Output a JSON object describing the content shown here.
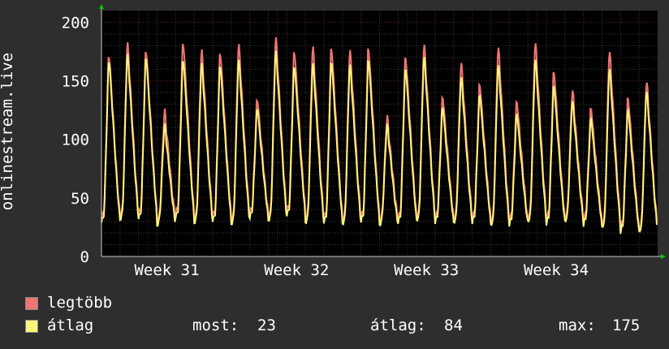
{
  "chart_data": {
    "type": "line",
    "title": "",
    "ylabel": "onlinestream.live",
    "xlabel": "",
    "ylim": [
      0,
      210
    ],
    "yticks": [
      0,
      50,
      100,
      150,
      200
    ],
    "xticks": [
      "Week 31",
      "Week 32",
      "Week 33",
      "Week 34"
    ],
    "x_range_days": 30,
    "week_tick_day_positions": [
      3,
      10,
      17,
      24
    ],
    "grid": true,
    "legend_placement": "bottom-left",
    "daily_peaks_max": [
      172,
      181,
      176,
      122,
      183,
      175,
      174,
      180,
      133,
      186,
      175,
      178,
      178,
      175,
      178,
      117,
      170,
      180,
      135,
      164,
      146,
      178,
      131,
      182,
      157,
      140,
      125,
      175,
      134,
      148
    ],
    "daily_peaks_avg": [
      167,
      172,
      170,
      110,
      168,
      164,
      163,
      167,
      125,
      175,
      162,
      164,
      166,
      163,
      168,
      110,
      160,
      170,
      126,
      152,
      137,
      163,
      120,
      168,
      145,
      131,
      116,
      160,
      124,
      140
    ],
    "daily_min": [
      32,
      34,
      35,
      29,
      36,
      31,
      33,
      30,
      36,
      33,
      38,
      31,
      32,
      30,
      33,
      29,
      32,
      33,
      32,
      31,
      32,
      29,
      30,
      32,
      31,
      32,
      30,
      27,
      24,
      23
    ],
    "series": [
      {
        "name": "legtöbb",
        "color": "#f07474"
      },
      {
        "name": "átlag",
        "color": "#fff47a"
      }
    ]
  },
  "colors": {
    "background": "#2e2e2e",
    "plot_bg": "#000000",
    "grid": "#3a3a3a",
    "grid_major": "#5a2222",
    "axis": "#c8c8c8",
    "arrow": "#00cc00"
  },
  "legend": {
    "max_label": "legtöbb",
    "avg_label": "átlag",
    "now_label": "most:",
    "now_value": "23",
    "avg_stat_label": "átlag:",
    "avg_stat_value": "84",
    "max_stat_label": "max:",
    "max_stat_value": "175"
  }
}
